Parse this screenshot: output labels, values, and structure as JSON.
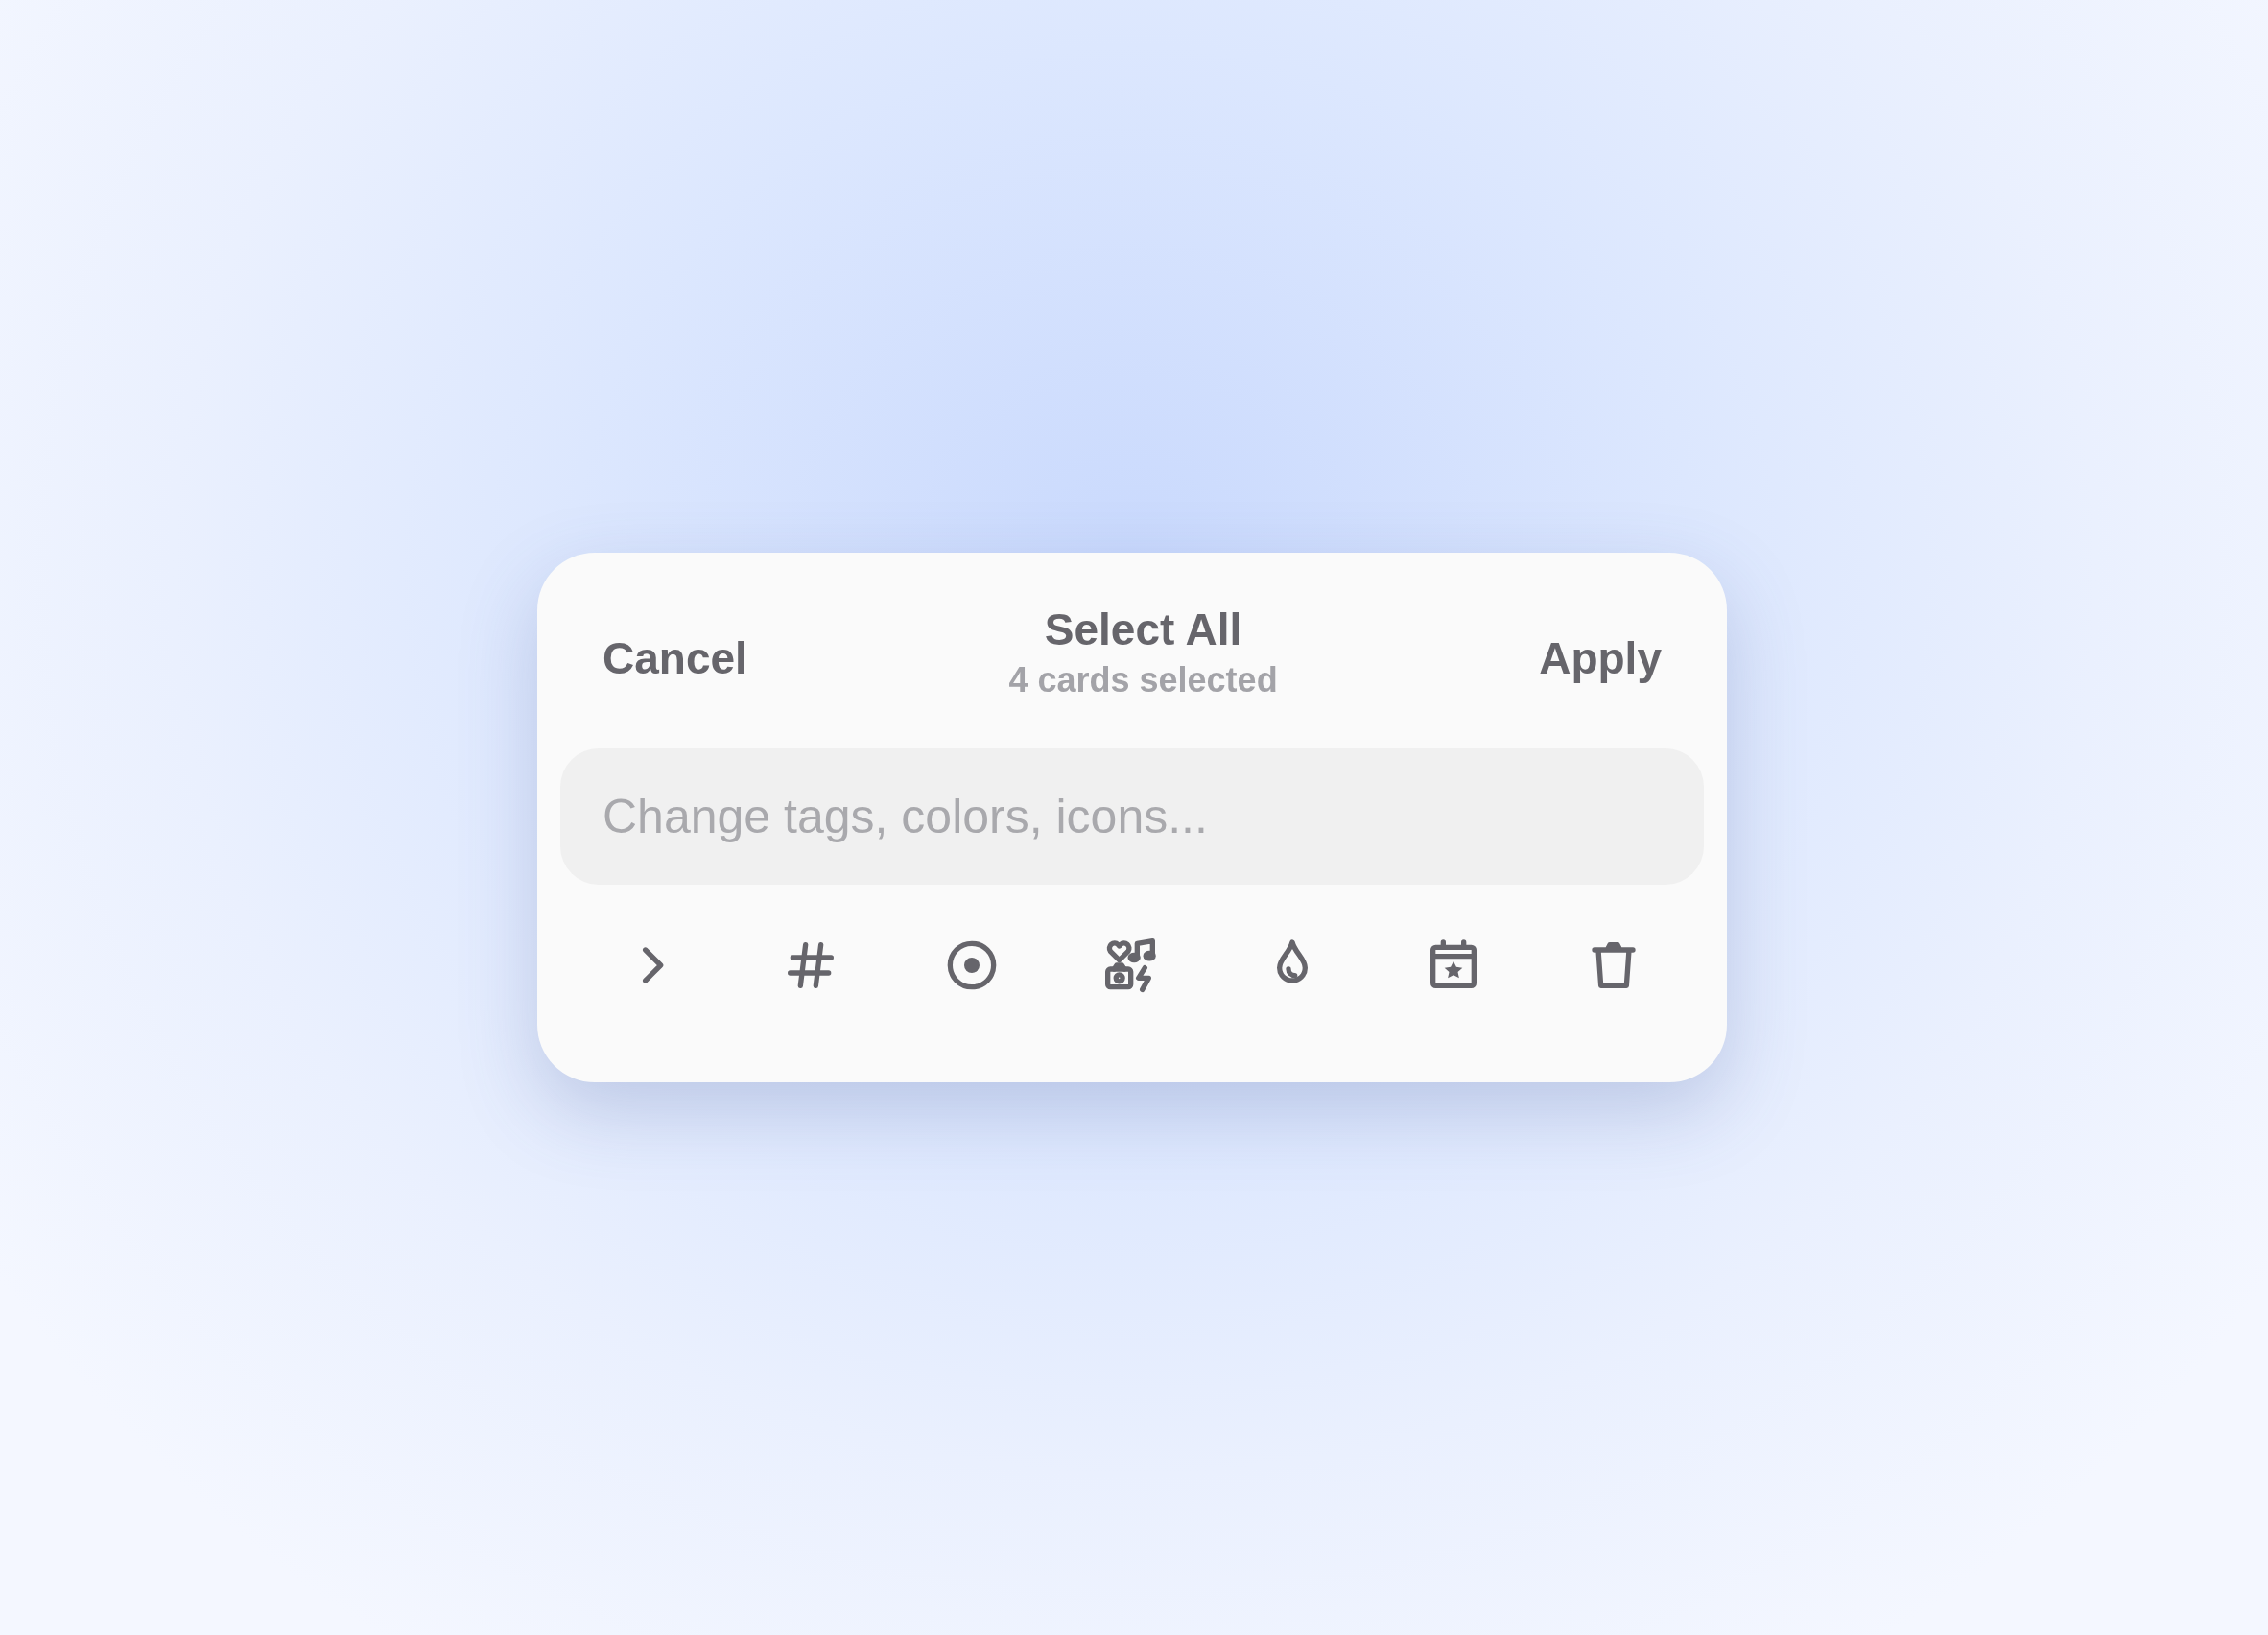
{
  "header": {
    "cancel": "Cancel",
    "title": "Select All",
    "subtitle": "4 cards selected",
    "apply": "Apply"
  },
  "search": {
    "placeholder": "Change tags, colors, icons..."
  },
  "toolbar": [
    {
      "kind": "chevron"
    },
    {
      "kind": "hash"
    },
    {
      "kind": "target"
    },
    {
      "kind": "media"
    },
    {
      "kind": "drop"
    },
    {
      "kind": "calendar"
    },
    {
      "kind": "trash"
    }
  ]
}
